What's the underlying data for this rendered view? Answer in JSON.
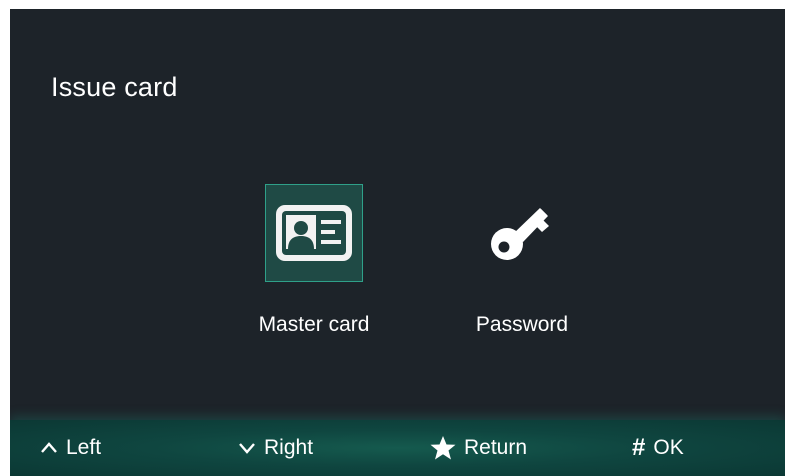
{
  "page": {
    "title": "Issue card"
  },
  "options": [
    {
      "label": "Master card",
      "icon": "id-card-icon",
      "selected": true
    },
    {
      "label": "Password",
      "icon": "key-icon",
      "selected": false
    }
  ],
  "footer": {
    "hints": [
      {
        "icon": "chevron-up-icon",
        "label": "Left"
      },
      {
        "icon": "chevron-down-icon",
        "label": "Right"
      },
      {
        "icon": "asterisk-icon",
        "label": "Return"
      },
      {
        "icon": "hash-icon",
        "symbol": "#",
        "label": "OK"
      }
    ]
  },
  "colors": {
    "screen_bg": "#1d2329",
    "selected_tile_bg": "#1f4a45",
    "selected_tile_border": "#2fa089",
    "footer_bg": "#0f4640"
  }
}
